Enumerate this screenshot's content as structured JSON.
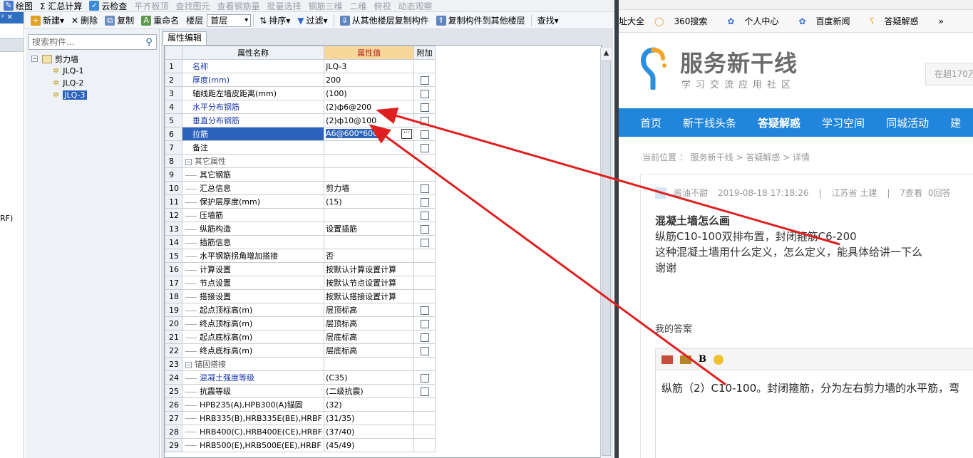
{
  "toolbar_top": {
    "items": [
      "绘图",
      "Σ 汇总计算",
      "云检查",
      "平齐板顶",
      "查找图元",
      "查看钢筋量",
      "批量选择",
      "钢筋三维",
      "二维",
      "俯视",
      "动态观察"
    ]
  },
  "toolbar": {
    "new": "新建",
    "delete": "删除",
    "copy": "复制",
    "rename": "重命名",
    "floor_label": "楼层",
    "floor_value": "首层",
    "sort": "排序",
    "filter": "过滤",
    "copy_from_other": "从其他楼层复制构件",
    "copy_to_other": "复制构件到其他楼层",
    "find": "查找"
  },
  "left_strip": {
    "rf": "RF)"
  },
  "tree": {
    "search_placeholder": "搜索构件...",
    "root": "剪力墙",
    "items": [
      "JLQ-1",
      "JLQ-2",
      "JLQ-3"
    ]
  },
  "props": {
    "tab": "属性编辑",
    "headers": {
      "name": "属性名称",
      "value": "属性值",
      "extra": "附加"
    },
    "rows": [
      {
        "n": "1",
        "name": "名称",
        "value": "JLQ-3",
        "cb": false,
        "style": "blue"
      },
      {
        "n": "2",
        "name": "厚度(mm)",
        "value": "200",
        "cb": true,
        "style": "blue"
      },
      {
        "n": "3",
        "name": "轴线距左墙皮距离(mm)",
        "value": "(100)",
        "cb": true,
        "style": ""
      },
      {
        "n": "4",
        "name": "水平分布钢筋",
        "value": "(2)ф6@200",
        "cb": true,
        "style": "blue"
      },
      {
        "n": "5",
        "name": "垂直分布钢筋",
        "value": "(2)ф10@100",
        "cb": true,
        "style": "blue"
      },
      {
        "n": "6",
        "name": "拉筋",
        "value": "A6@600*600",
        "cb": true,
        "style": "sel"
      },
      {
        "n": "7",
        "name": "备注",
        "value": "",
        "cb": true,
        "style": ""
      },
      {
        "n": "8",
        "name": "其它属性",
        "value": "",
        "cb": false,
        "style": "grp"
      },
      {
        "n": "9",
        "name": "其它钢筋",
        "value": "",
        "cb": false,
        "style": "sub"
      },
      {
        "n": "10",
        "name": "汇总信息",
        "value": "剪力墙",
        "cb": true,
        "style": "sub"
      },
      {
        "n": "11",
        "name": "保护层厚度(mm)",
        "value": "(15)",
        "cb": true,
        "style": "sub"
      },
      {
        "n": "12",
        "name": "压墙筋",
        "value": "",
        "cb": true,
        "style": "sub"
      },
      {
        "n": "13",
        "name": "纵筋构造",
        "value": "设置插筋",
        "cb": true,
        "style": "sub"
      },
      {
        "n": "14",
        "name": "插筋信息",
        "value": "",
        "cb": true,
        "style": "sub"
      },
      {
        "n": "15",
        "name": "水平钢筋拐角增加搭接",
        "value": "否",
        "cb": false,
        "style": "sub"
      },
      {
        "n": "16",
        "name": "计算设置",
        "value": "按默认计算设置计算",
        "cb": false,
        "style": "sub"
      },
      {
        "n": "17",
        "name": "节点设置",
        "value": "按默认节点设置计算",
        "cb": false,
        "style": "sub"
      },
      {
        "n": "18",
        "name": "搭接设置",
        "value": "按默认搭接设置计算",
        "cb": false,
        "style": "sub"
      },
      {
        "n": "19",
        "name": "起点顶标高(m)",
        "value": "层顶标高",
        "cb": true,
        "style": "sub"
      },
      {
        "n": "20",
        "name": "终点顶标高(m)",
        "value": "层顶标高",
        "cb": true,
        "style": "sub"
      },
      {
        "n": "21",
        "name": "起点底标高(m)",
        "value": "层底标高",
        "cb": true,
        "style": "sub"
      },
      {
        "n": "22",
        "name": "终点底标高(m)",
        "value": "层底标高",
        "cb": true,
        "style": "sub"
      },
      {
        "n": "23",
        "name": "锚固搭接",
        "value": "",
        "cb": false,
        "style": "grp"
      },
      {
        "n": "24",
        "name": "混凝土强度等级",
        "value": "(C35)",
        "cb": true,
        "style": "subblue"
      },
      {
        "n": "25",
        "name": "抗震等级",
        "value": "(二级抗震)",
        "cb": true,
        "style": "sub"
      },
      {
        "n": "26",
        "name": "HPB235(A),HPB300(A)锚固",
        "value": "(32)",
        "cb": false,
        "style": "sub"
      },
      {
        "n": "27",
        "name": "HRB335(B),HRB335E(BE),HRBF",
        "value": "(31/35)",
        "cb": false,
        "style": "sub"
      },
      {
        "n": "28",
        "name": "HRB400(C),HRB400E(CE),HRBF",
        "value": "(37/40)",
        "cb": false,
        "style": "sub"
      },
      {
        "n": "29",
        "name": "HRB500(E),HRB500E(EE),HRBF",
        "value": "(45/49)",
        "cb": false,
        "style": "sub"
      }
    ]
  },
  "browser": {
    "bookmarks": [
      "址大全",
      "360搜索",
      "个人中心",
      "百度新闻",
      "答疑解惑",
      "»"
    ],
    "logo_title": "服务新干线",
    "logo_sub": "学习交流应用社区",
    "search_placeholder": "在超170万",
    "nav": [
      "首页",
      "新干线头条",
      "答疑解惑",
      "学习空间",
      "同城活动",
      "建"
    ],
    "breadcrumb": "当前位置 ： 服务新干线 > 答疑解惑 > 详情",
    "meta": {
      "user": "酱油不甜",
      "date": "2019-08-18 17:18:26",
      "region": "江苏省  土建",
      "views": "7查看",
      "answers": "0回答"
    },
    "question_title": "混凝土墙怎么画",
    "question_line1": "纵筋C10-100双排布置，封闭箍筋C6-200",
    "question_line2": "这种混凝土墙用什么定义，怎么定义，能具体给讲一下么",
    "question_line3": "谢谢",
    "my_answer": "我的答案",
    "editor_bold": "B",
    "editor_text": "纵筋（2）C10-100。封闭箍筋，分为左右剪力墙的水平筋，弯"
  },
  "colors": {
    "accent_nav": "#2285dc",
    "arrow": "#e02020",
    "selection": "#2b63bf"
  }
}
